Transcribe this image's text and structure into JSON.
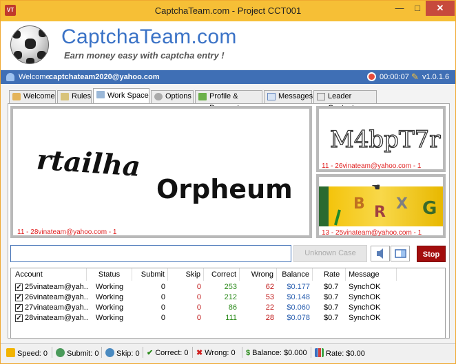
{
  "window": {
    "app_icon_text": "VT",
    "title": "CaptchaTeam.com - Project CCT001",
    "minimize": "—",
    "maximize": "□",
    "close": "✕"
  },
  "banner": {
    "title": "CaptchaTeam.com",
    "subtitle": "Earn money easy with captcha entry !"
  },
  "welcome": {
    "label": "Welcome",
    "email": "captchateam2020@yahoo.com",
    "timer": "00:00:07",
    "version": "v1.0.1.6"
  },
  "tabs": [
    {
      "label": "Welcome",
      "active": false
    },
    {
      "label": "Rules",
      "active": false
    },
    {
      "label": "Work Space",
      "active": true
    },
    {
      "label": "Options",
      "active": false
    },
    {
      "label": "Profile & Payment",
      "active": false
    },
    {
      "label": "Messages",
      "active": false
    },
    {
      "label": "Leader Contact",
      "active": false
    }
  ],
  "captchas": {
    "main": {
      "text1": "rtailha",
      "text2": "Orpheum",
      "caption": "11 - 28vinateam@yahoo.com - 1"
    },
    "side1": {
      "text": "M4bpT7r",
      "caption": "11 - 26vinateam@yahoo.com - 1"
    },
    "side2": {
      "letters": [
        "B",
        "R",
        "X",
        "G"
      ],
      "caption": "13 - 25vinateam@yahoo.com - 1"
    }
  },
  "controls": {
    "answer_value": "",
    "unknown_label": "Unknown Case",
    "stop_label": "Stop"
  },
  "table": {
    "columns": [
      "Account",
      "Status",
      "Submit",
      "Skip",
      "Correct",
      "Wrong",
      "Balance",
      "Rate",
      "Message"
    ],
    "rows": [
      {
        "checked": true,
        "account": "25vinateam@yah...",
        "status": "Working",
        "submit": "0",
        "skip": "0",
        "correct": "253",
        "wrong": "62",
        "balance": "$0.177",
        "rate": "$0.7",
        "message": "SynchOK"
      },
      {
        "checked": true,
        "account": "26vinateam@yah...",
        "status": "Working",
        "submit": "0",
        "skip": "0",
        "correct": "212",
        "wrong": "53",
        "balance": "$0.148",
        "rate": "$0.7",
        "message": "SynchOK"
      },
      {
        "checked": true,
        "account": "27vinateam@yah...",
        "status": "Working",
        "submit": "0",
        "skip": "0",
        "correct": "86",
        "wrong": "22",
        "balance": "$0.060",
        "rate": "$0.7",
        "message": "SynchOK"
      },
      {
        "checked": true,
        "account": "28vinateam@yah...",
        "status": "Working",
        "submit": "0",
        "skip": "0",
        "correct": "111",
        "wrong": "28",
        "balance": "$0.078",
        "rate": "$0.7",
        "message": "SynchOK"
      }
    ]
  },
  "status_bar": {
    "speed": "Speed: 0",
    "submit": "Submit: 0",
    "skip": "Skip: 0",
    "correct": "Correct: 0",
    "wrong": "Wrong: 0",
    "balance": "Balance: $0.000",
    "rate": "Rate: $0.00"
  },
  "colors": {
    "title_bar": "#f6bf36",
    "accent_blue": "#3f6fb5",
    "stop_red": "#a30d0d",
    "correct_green": "#2a8a1a",
    "wrong_red": "#c01818"
  }
}
